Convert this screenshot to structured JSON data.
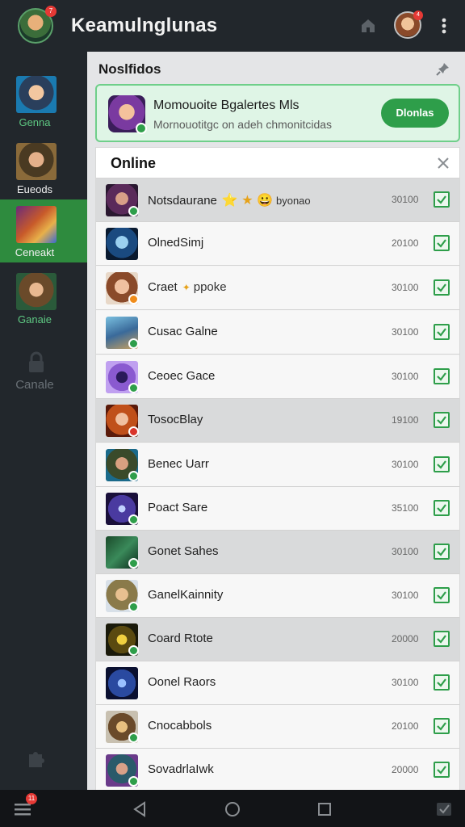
{
  "header": {
    "app_title": "Keamulnglunas",
    "badge_count": "7",
    "user_badge": "4"
  },
  "sidebar": {
    "items": [
      {
        "label": "Genna",
        "icon": "game-thumb-hero"
      },
      {
        "label": "Eueods",
        "icon": "game-thumb-warrior"
      },
      {
        "label": "Ceneakt",
        "icon": "game-thumb-battle"
      },
      {
        "label": "Ganaie",
        "icon": "game-thumb-archer"
      },
      {
        "label": "Canale",
        "icon": "lock-icon"
      }
    ]
  },
  "notifications": {
    "title": "Noslfidos",
    "card": {
      "headline": "Momouoite Bgalertes Mls",
      "subtext": "Mornouotitgc on adeh chmonitcidas",
      "button": "Dlonlas"
    }
  },
  "online": {
    "title": "Online",
    "rows": [
      {
        "name": "Notsdaurane",
        "extra": "byonao",
        "emoji": "⭐ ★ 😀",
        "value": "30100",
        "status": "green"
      },
      {
        "name": "OlnedSimj",
        "value": "20100",
        "status": "green"
      },
      {
        "name": "Craet",
        "extra": "ppoke",
        "value": "30100",
        "status": "orange"
      },
      {
        "name": "Cusac Galne",
        "value": "30100",
        "status": "green"
      },
      {
        "name": "Ceoec Gace",
        "value": "30100",
        "status": "green"
      },
      {
        "name": "TosocBlay",
        "value": "19100",
        "status": "red"
      },
      {
        "name": "Benec Uarr",
        "value": "30100",
        "status": "green"
      },
      {
        "name": "Poact Sare",
        "value": "35100",
        "status": "green"
      },
      {
        "name": "Gonet Sahes",
        "value": "30100",
        "status": "green"
      },
      {
        "name": "GanelKainnity",
        "value": "30100",
        "status": "green"
      },
      {
        "name": "Coard Rtote",
        "value": "20000",
        "status": "green"
      },
      {
        "name": "Oonel Raors",
        "value": "30100",
        "status": "green"
      },
      {
        "name": "Cnocabbols",
        "value": "20100",
        "status": "green"
      },
      {
        "name": "SovadrlaIwk",
        "value": "20000",
        "status": "green"
      }
    ]
  },
  "bottom_nav": {
    "badge": "11"
  },
  "colors": {
    "accent": "#2e9e4a",
    "sidebar_bg": "#22272c",
    "panel_bg": "#e4e5e7"
  }
}
